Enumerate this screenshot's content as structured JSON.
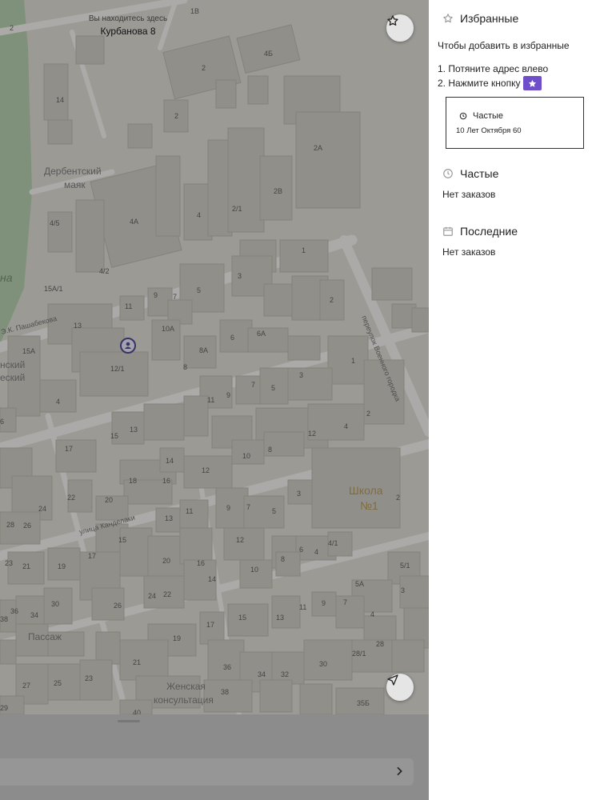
{
  "map": {
    "location_hint": "Вы находитесь здесь",
    "location_address": "Курбанова 8",
    "favorite_button_icon": "star-icon",
    "locate_button_icon": "navigation-arrow-icon",
    "labels": {
      "street_pashabekova": "Э.К. Пашабекова",
      "street_kandelaki": "улица Канделаки",
      "lane_voennogo": "переулок Военного городка",
      "poi_mayak": "Дербентский",
      "poi_mayak_2": "маяк",
      "poi_school": "Школа",
      "poi_school_2": "№1",
      "poi_passage": "Пассаж",
      "poi_clinic": "Женская",
      "poi_clinic_2": "консультация",
      "park_fragment": "на",
      "frag_1": "нский",
      "frag_2": "еский"
    },
    "house_numbers": [
      "1В",
      "2",
      "4Б",
      "2",
      "14",
      "2",
      "2А",
      "4А",
      "2В",
      "4",
      "2/1",
      "4/5",
      "4/2",
      "1",
      "3",
      "5",
      "7",
      "9",
      "11",
      "15А/1",
      "13",
      "15А",
      "4",
      "2",
      "10А",
      "6А",
      "6",
      "8А",
      "8",
      "1",
      "12/1",
      "3",
      "7",
      "5",
      "11",
      "9",
      "2",
      "4",
      "12",
      "6",
      "17",
      "15",
      "13",
      "8",
      "10",
      "14",
      "12",
      "18",
      "16",
      "22",
      "20",
      "24",
      "13",
      "11",
      "9",
      "7",
      "5",
      "3",
      "2",
      "28",
      "26",
      "15",
      "12",
      "6",
      "4",
      "4/1",
      "17",
      "19",
      "23",
      "21",
      "20",
      "16",
      "14",
      "10",
      "8",
      "5/1",
      "5А",
      "3",
      "30",
      "36",
      "34",
      "38",
      "26",
      "24",
      "22",
      "11",
      "9",
      "7",
      "4",
      "15",
      "13",
      "17",
      "19",
      "21",
      "36",
      "34",
      "32",
      "30",
      "28",
      "28/1",
      "25",
      "27",
      "23",
      "38",
      "29",
      "40",
      "35Б"
    ]
  },
  "bottom_sheet": {
    "chevron_icon": "chevron-right-icon"
  },
  "panel": {
    "favorites": {
      "icon": "star-outline-icon",
      "title": "Избранные",
      "hint": "Чтобы добавить в избранные",
      "step1": "1. Потяните адрес влево",
      "step2": "2. Нажмите кнопку",
      "step2_icon": "star-icon",
      "demo_card": {
        "icon": "clock-icon",
        "category": "Частые",
        "address": "10 Лет Октября 60"
      }
    },
    "frequent": {
      "icon": "clock-icon",
      "title": "Частые",
      "empty": "Нет заказов"
    },
    "recent": {
      "icon": "calendar-icon",
      "title": "Последние",
      "empty": "Нет заказов"
    }
  },
  "colors": {
    "accent": "#6f4fc9",
    "map_bg": "#d9d7cf",
    "building": "#c9c5bb",
    "park": "#a9c9a0",
    "school": "#f0dfa0",
    "road": "#f4f3ef"
  }
}
